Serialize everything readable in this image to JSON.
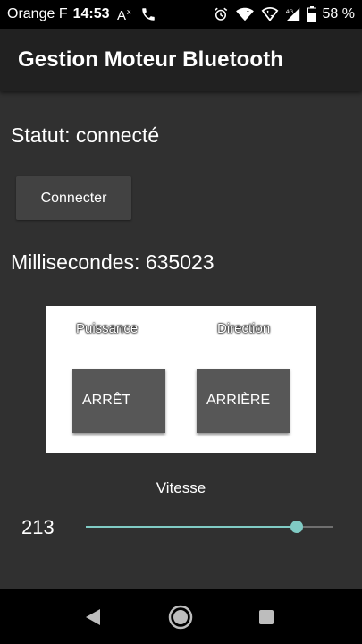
{
  "status_bar": {
    "carrier": "Orange F",
    "time": "14:53",
    "battery": "58 %",
    "icons": [
      "text-size-icon",
      "phone-icon",
      "alarm-icon",
      "wifi-icon",
      "wifi-call-icon",
      "signal-icon",
      "battery-icon"
    ]
  },
  "app_bar": {
    "title": "Gestion Moteur Bluetooth"
  },
  "main": {
    "status_text": "Statut: connecté",
    "connect_label": "Connecter",
    "millis_text": "Millisecondes: 635023"
  },
  "control_panel": {
    "power_label": "Puissance",
    "direction_label": "Direction",
    "power_button": "ARRÊT",
    "direction_button": "ARRIÈRE"
  },
  "speed": {
    "label": "Vitesse",
    "value": "213",
    "slider_fraction": 0.856
  },
  "nav_bar": {
    "icons": [
      "back-icon",
      "home-icon",
      "recent-apps-icon"
    ]
  },
  "colors": {
    "accent": "#80cbc4",
    "app_bar": "#212121",
    "background": "#303030"
  }
}
